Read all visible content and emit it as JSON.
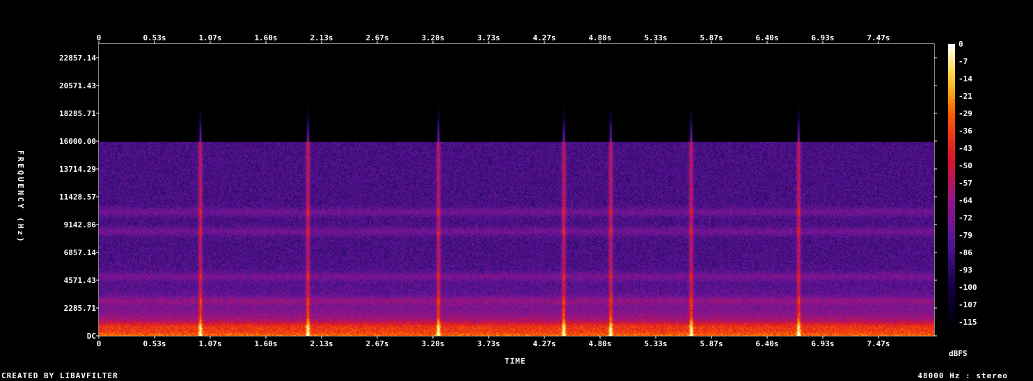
{
  "footer": {
    "credit": "CREATED BY LIBAVFILTER",
    "format": "48000 Hz : stereo"
  },
  "chart_data": {
    "type": "heatmap",
    "subtype": "spectrogram",
    "xlabel": "TIME",
    "ylabel": "FREQUENCY (Hz)",
    "colorbar_label": "dBFS",
    "x_ticks": [
      "0",
      "0.53s",
      "1.07s",
      "1.60s",
      "2.13s",
      "2.67s",
      "3.20s",
      "3.73s",
      "4.27s",
      "4.80s",
      "5.33s",
      "5.87s",
      "6.40s",
      "6.93s",
      "7.47s"
    ],
    "y_ticks": [
      "DC",
      "2285.71",
      "4571.43",
      "6857.14",
      "9142.86",
      "11428.57",
      "13714.29",
      "16000.00",
      "18285.71",
      "20571.43",
      "22857.14"
    ],
    "y_tick_values": [
      0,
      2285.71,
      4571.43,
      6857.14,
      9142.86,
      11428.57,
      13714.29,
      16000.0,
      18285.71,
      20571.43,
      22857.14
    ],
    "x_range_s": [
      0,
      8.0
    ],
    "y_range_hz": [
      0,
      24000
    ],
    "colorbar_ticks": [
      "0",
      "-7",
      "-14",
      "-21",
      "-29",
      "-36",
      "-43",
      "-50",
      "-57",
      "-64",
      "-72",
      "-79",
      "-86",
      "-93",
      "-100",
      "-107",
      "-115"
    ],
    "colorbar_values": [
      0,
      -7,
      -14,
      -21,
      -29,
      -36,
      -43,
      -50,
      -57,
      -64,
      -72,
      -79,
      -86,
      -93,
      -100,
      -107,
      -115
    ],
    "color_scale": "intensity",
    "content_cutoff_hz": 16000,
    "transients_s": [
      0.97,
      2.0,
      3.25,
      4.45,
      4.9,
      5.67,
      6.7
    ],
    "horizontal_bands_hz": [
      800,
      2900,
      4900,
      8600,
      10200
    ]
  }
}
